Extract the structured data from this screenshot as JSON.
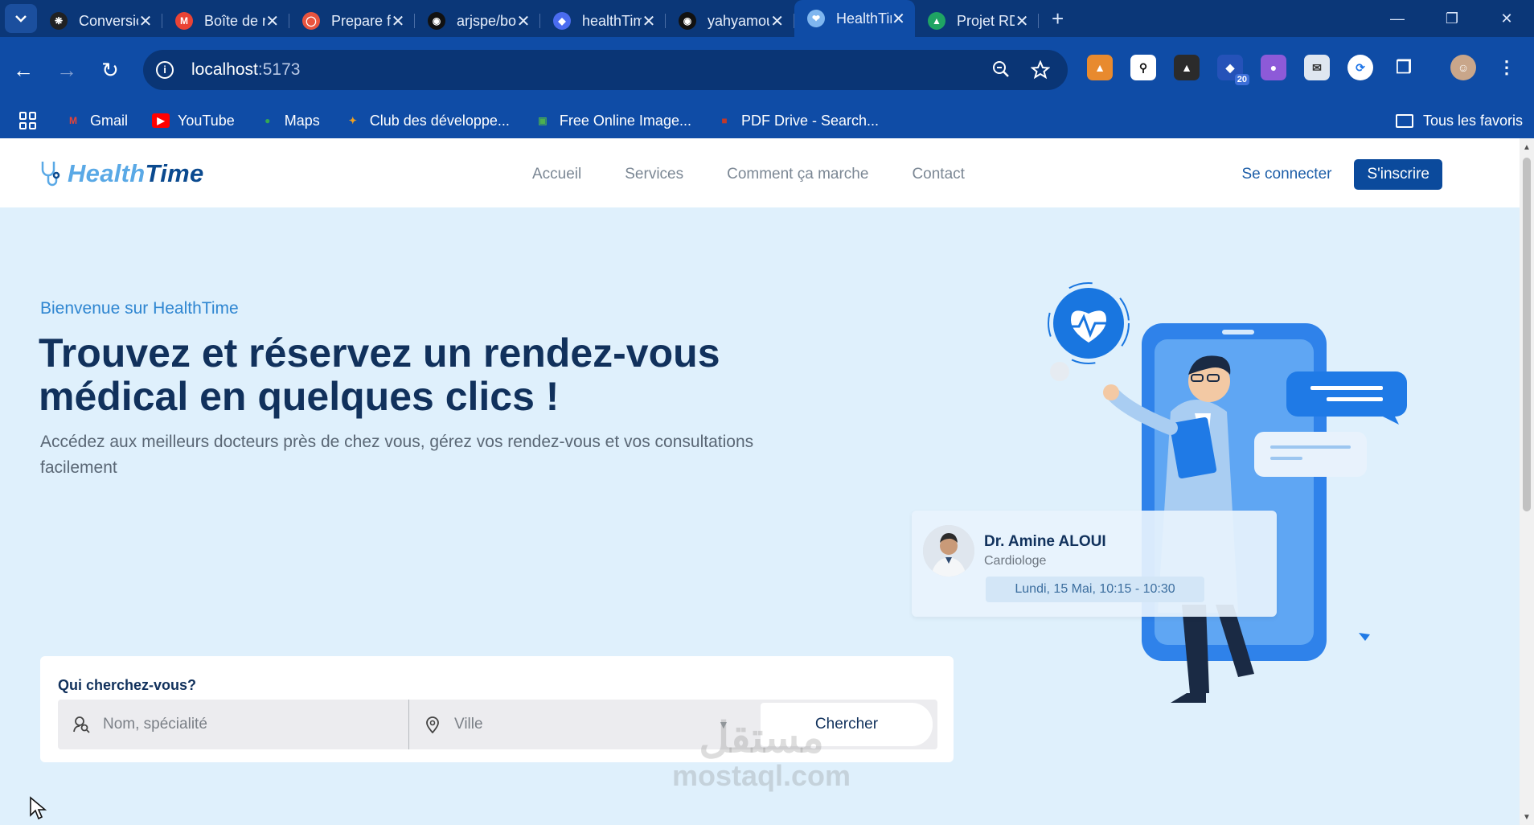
{
  "browser": {
    "tabs": [
      {
        "title": "Conversion",
        "icon": "openai-icon",
        "color": "#202123"
      },
      {
        "title": "Boîte de réception",
        "icon": "gmail-icon",
        "color": "#ea4335"
      },
      {
        "title": "Prepare for",
        "icon": "oracle-icon",
        "color": "#e8543f"
      },
      {
        "title": "arjspe/boe",
        "icon": "github-icon",
        "color": "#111111"
      },
      {
        "title": "healthTime",
        "icon": "app-icon",
        "color": "#4a6cf0"
      },
      {
        "title": "yahyamou",
        "icon": "github-icon",
        "color": "#111111"
      },
      {
        "title": "HealthTime",
        "icon": "stethoscope-icon",
        "color": "#7fb6ef",
        "active": true
      },
      {
        "title": "Projet RDV",
        "icon": "drive-icon",
        "color": "#1fa463"
      }
    ],
    "url_host": "localhost",
    "url_port": ":5173",
    "bookmarks": [
      {
        "label": "Gmail",
        "icon": "gmail-icon",
        "color": "#ea4335"
      },
      {
        "label": "YouTube",
        "icon": "youtube-icon",
        "color": "#ff0000"
      },
      {
        "label": "Maps",
        "icon": "maps-icon",
        "color": "#34a853"
      },
      {
        "label": "Club des développe...",
        "icon": "developpez-icon",
        "color": "#f0a020"
      },
      {
        "label": "Free Online Image...",
        "icon": "image-icon",
        "color": "#4caf50"
      },
      {
        "label": "PDF Drive - Search...",
        "icon": "pdf-icon",
        "color": "#c0392b"
      }
    ],
    "all_bookmarks": "Tous les favoris",
    "extension_badge": "20"
  },
  "site": {
    "logo_part1": "Health",
    "logo_part2": "Time",
    "nav": [
      "Accueil",
      "Services",
      "Comment ça marche",
      "Contact"
    ],
    "login": "Se connecter",
    "signup": "S'inscrire",
    "colors": {
      "primary": "#0b4a9c",
      "heading": "#11315c",
      "accent": "#2f86d1",
      "hero_bg": "#dff0fc"
    }
  },
  "hero": {
    "kicker": "Bienvenue sur HealthTime",
    "title": "Trouvez et réservez un rendez-vous médical en quelques clics !",
    "subtitle": "Accédez aux meilleurs docteurs près de chez vous, gérez vos rendez-vous et vos consultations facilement"
  },
  "search": {
    "label": "Qui cherchez-vous?",
    "name_placeholder": "Nom, spécialité",
    "city_placeholder": "Ville",
    "button": "Chercher"
  },
  "doctor_card": {
    "name": "Dr. Amine ALOUI",
    "specialty": "Cardiologe",
    "slot": "Lundi, 15 Mai, 10:15 - 10:30"
  },
  "watermark": {
    "arabic": "مستقل",
    "latin": "mostaql.com"
  }
}
